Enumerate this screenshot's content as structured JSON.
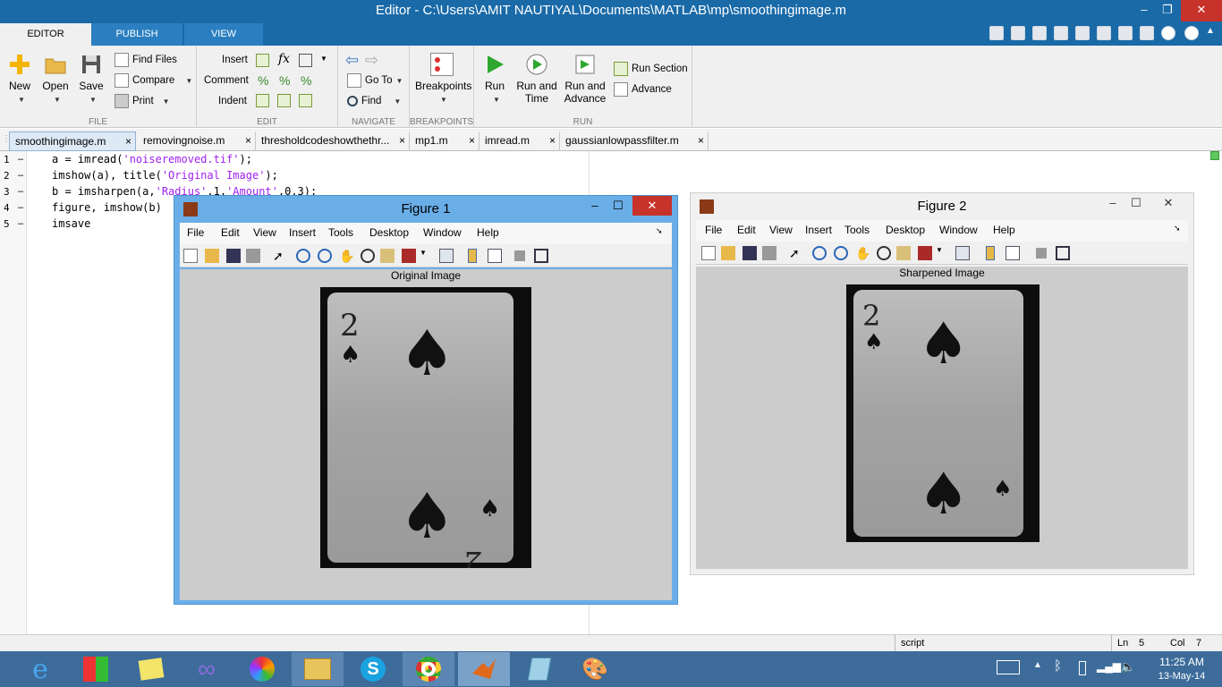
{
  "window": {
    "title": "Editor - C:\\Users\\AMIT NAUTIYAL\\Documents\\MATLAB\\mp\\smoothingimage.m",
    "min": "–",
    "restore": "❐",
    "close": "✕"
  },
  "ribbon_tabs": [
    "EDITOR",
    "PUBLISH",
    "VIEW"
  ],
  "groups": {
    "file": "FILE",
    "edit": "EDIT",
    "navigate": "NAVIGATE",
    "breakpoints": "BREAKPOINTS",
    "run": "RUN"
  },
  "file": {
    "new": "New",
    "open": "Open",
    "save": "Save",
    "find_files": "Find Files",
    "compare": "Compare",
    "print": "Print"
  },
  "edit": {
    "insert": "Insert",
    "comment": "Comment",
    "indent": "Indent"
  },
  "navigate": {
    "goto": "Go To",
    "find": "Find"
  },
  "breakpoints": {
    "label": "Breakpoints"
  },
  "run": {
    "run": "Run",
    "run_time_1": "Run and",
    "run_time_2": "Time",
    "run_adv_1": "Run and",
    "run_adv_2": "Advance",
    "run_section": "Run Section",
    "advance": "Advance"
  },
  "file_tabs": [
    "smoothingimage.m",
    "removingnoise.m",
    "thresholdcodeshowthethr...",
    "mp1.m",
    "imread.m",
    "gaussianlowpassfilter.m"
  ],
  "code": {
    "line_numbers": [
      "1",
      "2",
      "3",
      "4",
      "5"
    ],
    "l1a": "a = imread(",
    "l1s": "'noiseremoved.tif'",
    "l1b": ");",
    "l2a": "imshow(a), title(",
    "l2s": "'Original Image'",
    "l2b": ");",
    "l3a": "b = imsharpen(a,",
    "l3s1": "'Radius'",
    "l3m": ",1,",
    "l3s2": "'Amount'",
    "l3b": ",0.3);",
    "l4": "figure, imshow(b)",
    "l5": "imsave"
  },
  "status": {
    "mode": "script",
    "ln_label": "Ln",
    "ln": "5",
    "col_label": "Col",
    "col": "7"
  },
  "figure1": {
    "title": "Figure 1",
    "axes_title": "Original Image"
  },
  "figure2": {
    "title": "Figure 2",
    "axes_title": "Sharpened Image"
  },
  "fig_menu": [
    "File",
    "Edit",
    "View",
    "Insert",
    "Tools",
    "Desktop",
    "Window",
    "Help"
  ],
  "clock": {
    "time": "11:25 AM",
    "date": "13-May-14"
  }
}
